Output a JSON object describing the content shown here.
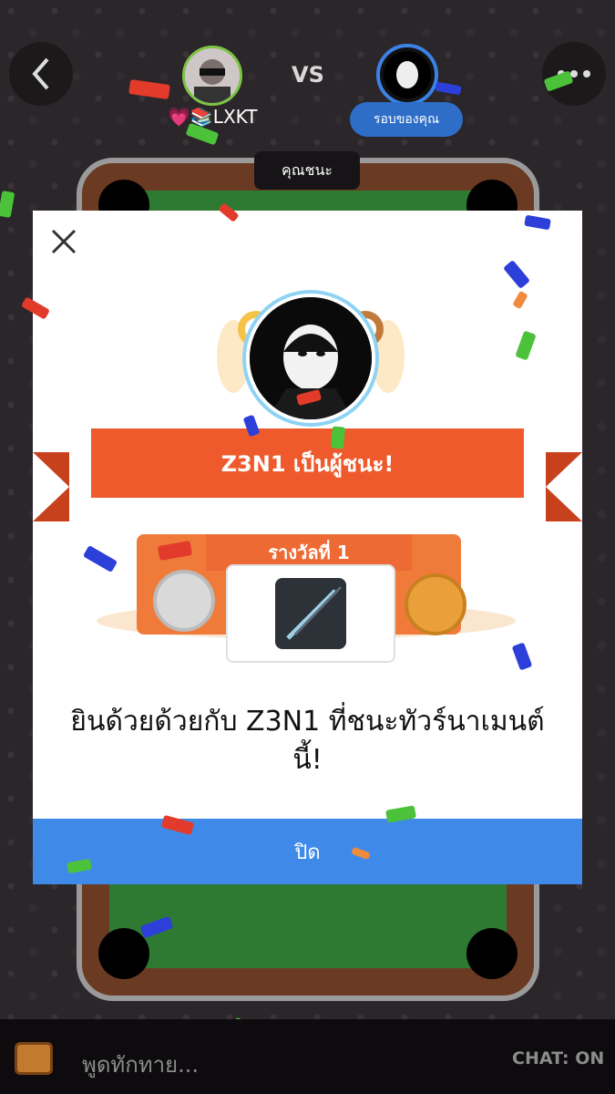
{
  "header": {
    "player_name": "💗📚LXKT",
    "vs_label": "VS",
    "turn_badge": "รอบของคุณ",
    "winner_tag": "คุณชนะ"
  },
  "modal": {
    "winner_title": "Z3N1 เป็นผู้ชนะ!",
    "prize_label": "รางวัลที่ 1",
    "congrats_text": "ยินด้วยด้วยกับ Z3N1 ที่ชนะทัวร์นาเมนต์นี้!",
    "close_button": "ปิด"
  },
  "chat": {
    "placeholder": "พูดทักทาย...",
    "toggle": "CHAT: ON"
  },
  "colors": {
    "ribbon": "#ee5a2c",
    "close_button": "#3f8ae8",
    "turn_badge": "#2e6ec9",
    "felt": "#2f7a33"
  },
  "icons": [
    "back-arrow-icon",
    "more-dots-icon",
    "close-icon",
    "chest-icon",
    "cue-icon",
    "trophy-icon"
  ]
}
